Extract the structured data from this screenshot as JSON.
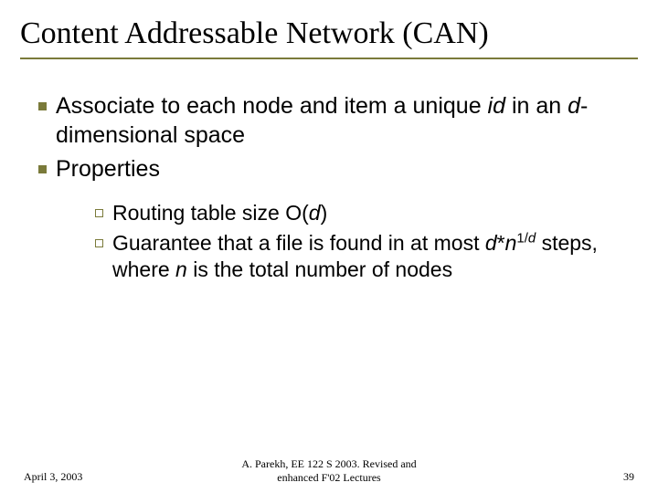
{
  "title": "Content Addressable Network (CAN)",
  "bullets": {
    "b1": {
      "pre": "Associate to each node and item a unique ",
      "id": "id",
      "mid": " in an ",
      "d": "d",
      "post": "-dimensional space"
    },
    "b2": "Properties",
    "s1": {
      "pre": "Routing table size O(",
      "d": "d",
      "post": ")"
    },
    "s2": {
      "pre": "Guarantee that a file is found in at most ",
      "d": "d",
      "star": "*",
      "n": "n",
      "exp_pre": "1/",
      "exp_d": "d",
      "mid": " steps, where ",
      "n2": "n",
      "post": " is the total number of nodes"
    }
  },
  "footer": {
    "date": "April 3, 2003",
    "center1": "A. Parekh, EE 122 S 2003. Revised and",
    "center2": "enhanced  F'02 Lectures",
    "page": "39"
  }
}
